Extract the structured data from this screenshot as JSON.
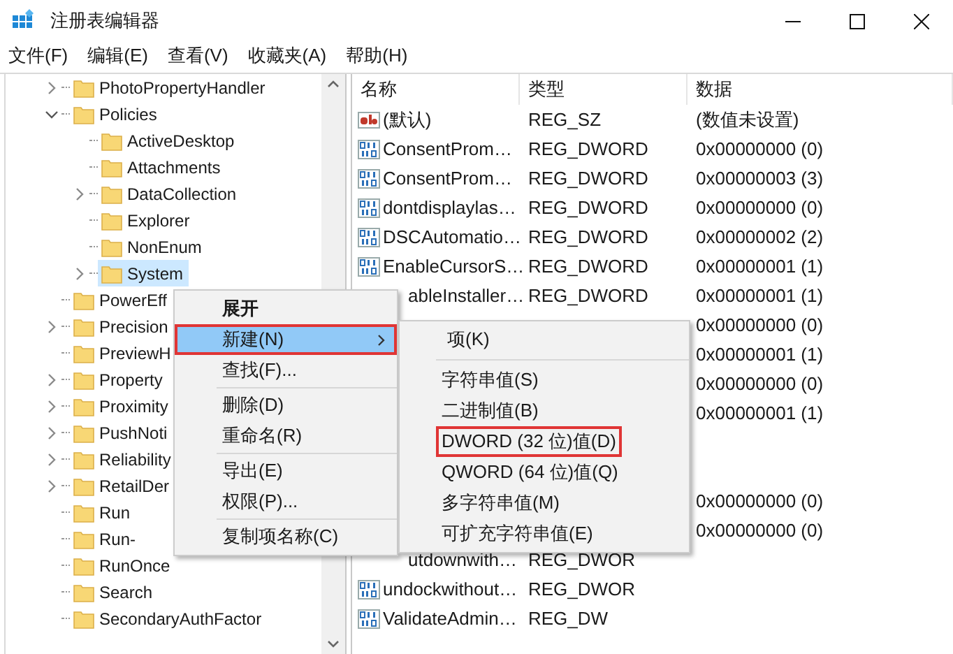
{
  "window": {
    "title": "注册表编辑器"
  },
  "menu_bar": [
    "文件(F)",
    "编辑(E)",
    "查看(V)",
    "收藏夹(A)",
    "帮助(H)"
  ],
  "tree": [
    {
      "label": "PhotoPropertyHandler",
      "has_children": true,
      "expanded": false,
      "selected": false
    },
    {
      "label": "Policies",
      "has_children": true,
      "expanded": true,
      "selected": false,
      "children": [
        {
          "label": "ActiveDesktop",
          "has_children": false,
          "selected": false
        },
        {
          "label": "Attachments",
          "has_children": false,
          "selected": false
        },
        {
          "label": "DataCollection",
          "has_children": true,
          "expanded": false,
          "selected": false
        },
        {
          "label": "Explorer",
          "has_children": false,
          "selected": false
        },
        {
          "label": "NonEnum",
          "has_children": false,
          "selected": false
        },
        {
          "label": "System",
          "has_children": true,
          "expanded": false,
          "selected": true
        }
      ]
    },
    {
      "label": "PowerEff",
      "has_children": false,
      "selected": false
    },
    {
      "label": "Precision",
      "has_children": true,
      "expanded": false,
      "selected": false
    },
    {
      "label": "PreviewH",
      "has_children": false,
      "selected": false
    },
    {
      "label": "Property",
      "has_children": true,
      "expanded": false,
      "selected": false
    },
    {
      "label": "Proximity",
      "has_children": true,
      "expanded": false,
      "selected": false
    },
    {
      "label": "PushNoti",
      "has_children": true,
      "expanded": false,
      "selected": false
    },
    {
      "label": "Reliability",
      "has_children": true,
      "expanded": false,
      "selected": false
    },
    {
      "label": "RetailDer",
      "has_children": true,
      "expanded": false,
      "selected": false
    },
    {
      "label": "Run",
      "has_children": false,
      "selected": false
    },
    {
      "label": "Run-",
      "has_children": false,
      "selected": false
    },
    {
      "label": "RunOnce",
      "has_children": false,
      "selected": false
    },
    {
      "label": "Search",
      "has_children": false,
      "selected": false
    },
    {
      "label": "SecondaryAuthFactor",
      "has_children": false,
      "selected": false
    }
  ],
  "values": {
    "columns": [
      "名称",
      "类型",
      "数据"
    ],
    "rows": [
      {
        "kind": "string",
        "name": "(默认)",
        "type": "REG_SZ",
        "data": "(数值未设置)"
      },
      {
        "kind": "dword",
        "name": "ConsentProm…",
        "type": "REG_DWORD",
        "data": "0x00000000 (0)"
      },
      {
        "kind": "dword",
        "name": "ConsentProm…",
        "type": "REG_DWORD",
        "data": "0x00000003 (3)"
      },
      {
        "kind": "dword",
        "name": "dontdisplaylas…",
        "type": "REG_DWORD",
        "data": "0x00000000 (0)"
      },
      {
        "kind": "dword",
        "name": "DSCAutomatio…",
        "type": "REG_DWORD",
        "data": "0x00000002 (2)"
      },
      {
        "kind": "dword",
        "name": "EnableCursorS…",
        "type": "REG_DWORD",
        "data": "0x00000001 (1)"
      },
      {
        "kind": "covered",
        "name": "ableInstaller…",
        "type": "REG_DWORD",
        "data": "0x00000001 (1)"
      },
      {
        "kind": "covered",
        "data": "0x00000000 (0)"
      },
      {
        "kind": "covered",
        "data": "0x00000001 (1)"
      },
      {
        "kind": "covered",
        "data": "0x00000000 (0)"
      },
      {
        "kind": "covered",
        "data": "0x00000001 (1)"
      },
      {
        "kind": "covered"
      },
      {
        "kind": "covered"
      },
      {
        "kind": "covered",
        "data": "0x00000000 (0)"
      },
      {
        "kind": "covered",
        "data": "0x00000000 (0)"
      },
      {
        "kind": "covered",
        "name": "utdownwith…",
        "type": "REG_DWOR"
      },
      {
        "kind": "dword",
        "name": "undockwithout…",
        "type": "REG_DWOR"
      },
      {
        "kind": "dword",
        "name": "ValidateAdmin…",
        "type": "REG_DW"
      }
    ]
  },
  "context_menu": {
    "groups": [
      [
        {
          "label": "展开",
          "bold": true,
          "selected": false,
          "outlined": false,
          "has_submenu": false
        },
        {
          "label": "新建(N)",
          "bold": false,
          "selected": true,
          "outlined": true,
          "has_submenu": true
        },
        {
          "label": "查找(F)...",
          "bold": false,
          "selected": false,
          "outlined": false,
          "has_submenu": false
        }
      ],
      [
        {
          "label": "删除(D)",
          "bold": false,
          "selected": false,
          "outlined": false,
          "has_submenu": false
        },
        {
          "label": "重命名(R)",
          "bold": false,
          "selected": false,
          "outlined": false,
          "has_submenu": false
        }
      ],
      [
        {
          "label": "导出(E)",
          "bold": false,
          "selected": false,
          "outlined": false,
          "has_submenu": false
        },
        {
          "label": "权限(P)...",
          "bold": false,
          "selected": false,
          "outlined": false,
          "has_submenu": false
        }
      ],
      [
        {
          "label": "复制项名称(C)",
          "bold": false,
          "selected": false,
          "outlined": false,
          "has_submenu": false
        }
      ]
    ]
  },
  "submenu": {
    "groups": [
      [
        {
          "label": "项(K)",
          "outlined": false
        }
      ],
      [
        {
          "label": "字符串值(S)",
          "outlined": false
        },
        {
          "label": "二进制值(B)",
          "outlined": false
        },
        {
          "label": "DWORD (32 位)值(D)",
          "outlined": true
        },
        {
          "label": "QWORD (64 位)值(Q)",
          "outlined": false
        },
        {
          "label": "多字符串值(M)",
          "outlined": false
        },
        {
          "label": "可扩充字符串值(E)",
          "outlined": false
        }
      ]
    ]
  }
}
